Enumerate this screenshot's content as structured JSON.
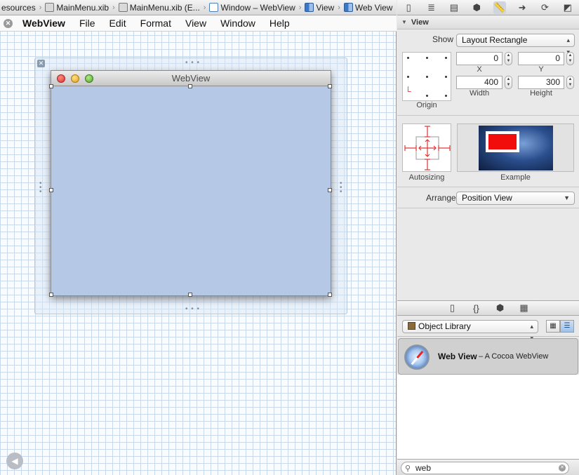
{
  "breadcrumb": {
    "items": [
      "esources",
      "MainMenu.xib",
      "MainMenu.xib (E...",
      "Window – WebView",
      "View",
      "Web View"
    ]
  },
  "menubar": {
    "app": "WebView",
    "items": [
      "File",
      "Edit",
      "Format",
      "View",
      "Window",
      "Help"
    ]
  },
  "canvas": {
    "window_title": "WebView",
    "webview_color": "#b5c9e7"
  },
  "inspector": {
    "section_title": "View",
    "show_label": "Show",
    "show_value": "Layout Rectangle",
    "x_value": "0",
    "y_value": "0",
    "width_value": "400",
    "height_value": "300",
    "x_caption": "X",
    "y_caption": "Y",
    "width_caption": "Width",
    "height_caption": "Height",
    "origin_caption": "Origin",
    "autosizing_caption": "Autosizing",
    "example_caption": "Example",
    "arrange_label": "Arrange",
    "arrange_value": "Position View"
  },
  "library": {
    "chooser_value": "Object Library",
    "item_title": "Web View",
    "item_subtitle": "– A Cocoa WebView",
    "filter_value": "web"
  }
}
